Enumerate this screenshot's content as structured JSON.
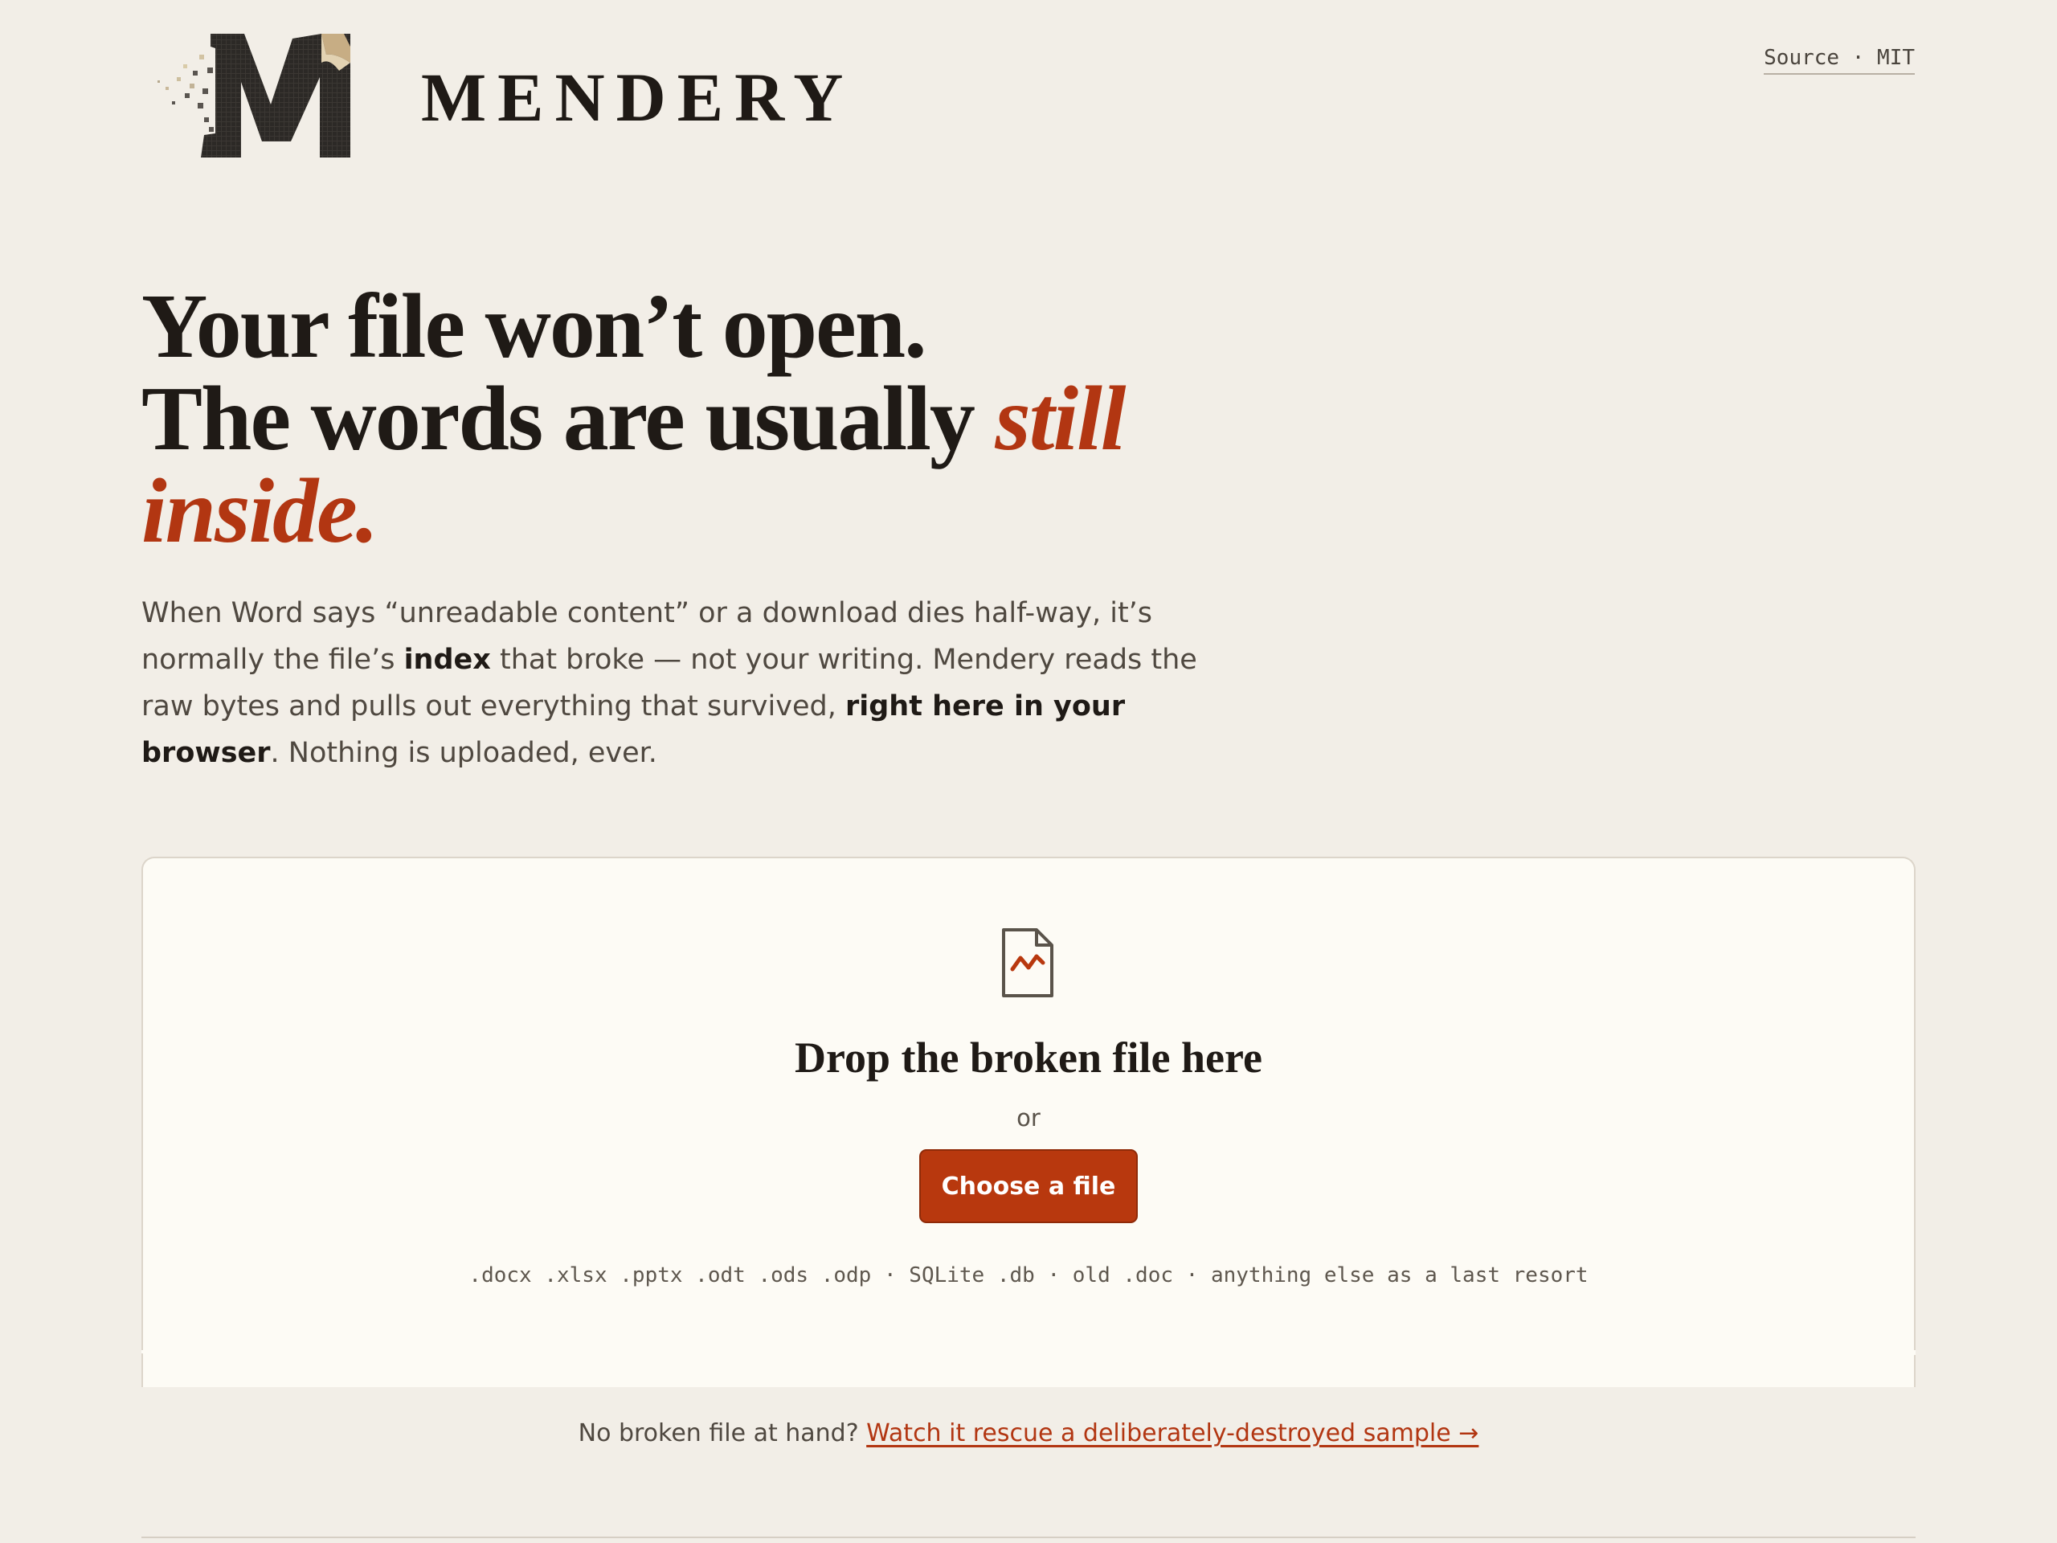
{
  "header": {
    "brand": "MENDERY",
    "source_link": "Source · MIT",
    "logo_icon": "pixelated-letter-m-icon"
  },
  "hero": {
    "title_line1": "Your file won’t open.",
    "title_line2_plain": "The words are usually ",
    "title_line2_accent": "still",
    "title_line3_accent": "inside.",
    "body_part1": "When Word says “unreadable content” or a download dies half-way, it’s normally the file’s ",
    "body_bold1": "index",
    "body_part2": " that broke — not your writing. Mendery reads the raw bytes and pulls out everything that survived, ",
    "body_bold2": "right here in your browser",
    "body_part3": ". Nothing is uploaded, ever."
  },
  "dropzone": {
    "icon": "broken-file-icon",
    "title": "Drop the broken file here",
    "or_label": "or",
    "button_label": "Choose a file",
    "formats": ".docx .xlsx .pptx .odt .ods .odp · SQLite .db · old .doc · anything else as a last resort"
  },
  "sample": {
    "prompt": "No broken file at hand? ",
    "link_label": "Watch it rescue a deliberately-destroyed sample →"
  },
  "colors": {
    "accent": "#b8380e",
    "background": "#f2eee7",
    "card": "#fdfbf5",
    "ink": "#1f1a16"
  }
}
